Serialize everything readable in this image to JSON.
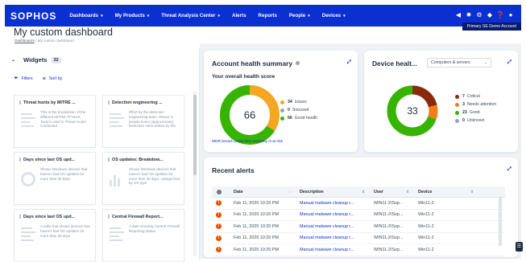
{
  "nav": {
    "logo": "SOPHOS",
    "items": [
      {
        "label": "Dashboards",
        "has_caret": true
      },
      {
        "label": "My Products",
        "has_caret": true
      },
      {
        "label": "Threat Analysis Center",
        "has_caret": true
      },
      {
        "label": "Alerts",
        "has_caret": false
      },
      {
        "label": "Reports",
        "has_caret": false
      },
      {
        "label": "People",
        "has_caret": true
      },
      {
        "label": "Devices",
        "has_caret": true
      }
    ],
    "icons": [
      "megaphone-icon",
      "settings-icon",
      "gear-icon",
      "bell-icon",
      "help-icon",
      "user-icon"
    ],
    "demo_badge": "Primary SE Demo Account"
  },
  "page": {
    "title": "My custom dashboard",
    "breadcrumb": {
      "link": "Dashboards",
      "separator": "/",
      "current": "My custom dashboard"
    }
  },
  "widgets": {
    "header": "Widgets",
    "count": "32",
    "filters_label": "Filters",
    "sort_label": "Sort by",
    "cards": [
      {
        "title": "Threat hunts by MITRE ...",
        "desc": "This is the breakdown of the different MITRE ATT&CK Tactics used in Threat Hunts conducted.",
        "thumb": "lines"
      },
      {
        "title": "Detection engineering ...",
        "desc": "Effort by the detection engineering team, shown in people hours (approximate). Detection rules written by the",
        "thumb": "lines"
      },
      {
        "title": "Days since last OS upd...",
        "desc": "Shows Windows devices that haven't had OS updates for more than 30 days",
        "thumb": "circle"
      },
      {
        "title": "OS updates: Breakdow...",
        "desc": "Shows Windows devices that haven't had OS updates for more than 30 days, categorized by OS type",
        "thumb": "bars"
      },
      {
        "title": "Days since last OS upd...",
        "desc": "A table that shows devices that haven't had OS updates for more than 30 days",
        "thumb": "lines"
      },
      {
        "title": "Central Firewall Report...",
        "desc": "A date showing Central Firewall Reporting status.",
        "thumb": "lines"
      }
    ]
  },
  "account_health": {
    "title": "Account health summary",
    "subtitle": "Your overall health score",
    "score": "66",
    "legend": [
      {
        "count": "34",
        "label": "Issues",
        "color": "#f5a623"
      },
      {
        "count": "0",
        "label": "Snoozed",
        "color": "#9aa3b1"
      },
      {
        "count": "66",
        "label": "Good health",
        "color": "#36b400"
      }
    ],
    "warranty_link": "MDR breach protection warranty is at risk",
    "chart_data": {
      "type": "pie",
      "categories": [
        "Issues",
        "Snoozed",
        "Good health"
      ],
      "values": [
        34,
        0,
        66
      ]
    }
  },
  "device_health": {
    "title": "Device healt...",
    "dropdown": "Computers & servers",
    "total": "33",
    "legend": [
      {
        "count": "7",
        "label": "Critical",
        "color": "#8b2a0b"
      },
      {
        "count": "3",
        "label": "Needs attention",
        "color": "#f07f1a"
      },
      {
        "count": "23",
        "label": "Good",
        "color": "#36b400"
      },
      {
        "count": "0",
        "label": "Unknown",
        "color": "#9aa3b1"
      }
    ],
    "chart_data": {
      "type": "pie",
      "categories": [
        "Critical",
        "Needs attention",
        "Good",
        "Unknown"
      ],
      "values": [
        7,
        3,
        23,
        0
      ]
    }
  },
  "recent_alerts": {
    "title": "Recent alerts",
    "columns": [
      "Date",
      "Description",
      "User",
      "Device"
    ],
    "rows": [
      {
        "date": "Feb 11, 2025 10:20 PM",
        "description": "Manual malware cleanup r...",
        "user": "WIN11-2\\Sop...",
        "device": "Win11-2"
      },
      {
        "date": "Feb 11, 2025 10:20 PM",
        "description": "Manual malware cleanup r...",
        "user": "WIN11-2\\Sop...",
        "device": "Win11-2"
      },
      {
        "date": "Feb 11, 2025 10:20 PM",
        "description": "Manual malware cleanup r...",
        "user": "WIN11-2\\Sop...",
        "device": "Win11-2"
      },
      {
        "date": "Feb 11, 2025 10:20 PM",
        "description": "Manual malware cleanup r...",
        "user": "WIN11-2\\Sop...",
        "device": "Win11-2"
      },
      {
        "date": "Feb 11, 2025 10:20 PM",
        "description": "Manual malware cleanup r...",
        "user": "WIN11-2\\Sop...",
        "device": "Win11-2"
      }
    ]
  },
  "colors": {
    "brand": "#0c2fd1",
    "alert": "#e65100"
  }
}
